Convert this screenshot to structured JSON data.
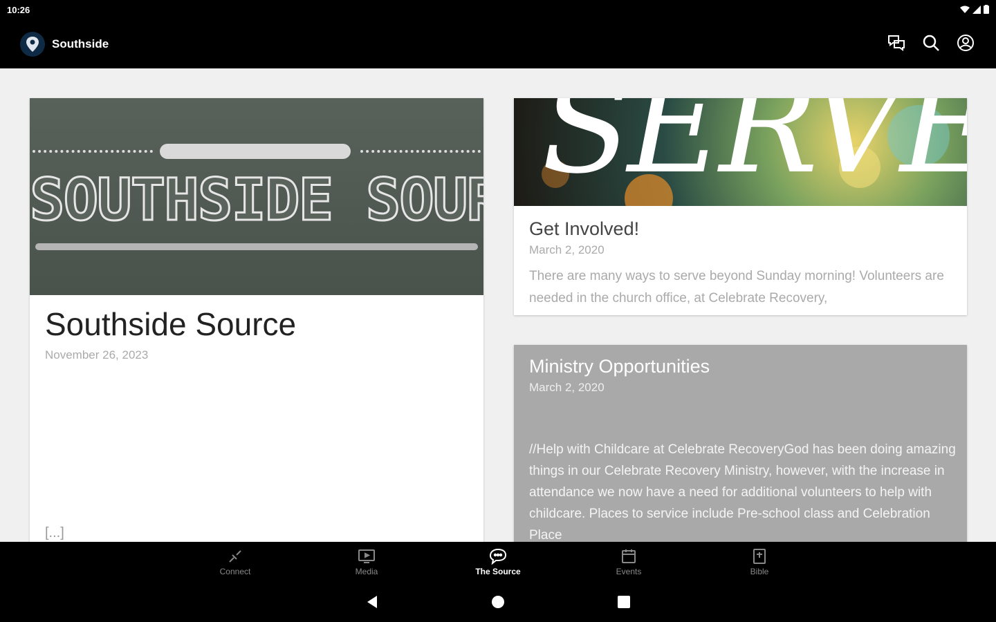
{
  "status_bar": {
    "time": "10:26"
  },
  "app_bar": {
    "title": "Southside"
  },
  "cards": {
    "source": {
      "banner_text": "SOUTHSIDE SOURCE",
      "title": "Southside Source",
      "date": "November 26, 2023",
      "more": "[...]"
    },
    "serve": {
      "banner_text": "SERVE",
      "title": "Get Involved!",
      "date": "March 2, 2020",
      "excerpt": "There are many ways to serve beyond Sunday morning! Volunteers are needed in the church office, at Celebrate Recovery,"
    },
    "ministry": {
      "title": "Ministry Opportunities",
      "date": "March 2, 2020",
      "excerpt": "//Help with Childcare at Celebrate RecoveryGod has been doing amazing things in our Celebrate Recovery Ministry, however, with the increase in attendance we now have a need for additional volunteers to help with childcare.  Places to service include Pre-school class and Celebration Place"
    }
  },
  "bottom_nav": {
    "items": [
      {
        "label": "Connect",
        "icon": "connect-icon"
      },
      {
        "label": "Media",
        "icon": "tv-icon"
      },
      {
        "label": "The Source",
        "icon": "chat-bubble-icon",
        "active": true
      },
      {
        "label": "Events",
        "icon": "calendar-icon"
      },
      {
        "label": "Bible",
        "icon": "bible-icon"
      }
    ]
  },
  "colors": {
    "app_bar": "#000000",
    "content_bg": "#f0f0f0",
    "ministry_card": "#a9a9a9"
  }
}
